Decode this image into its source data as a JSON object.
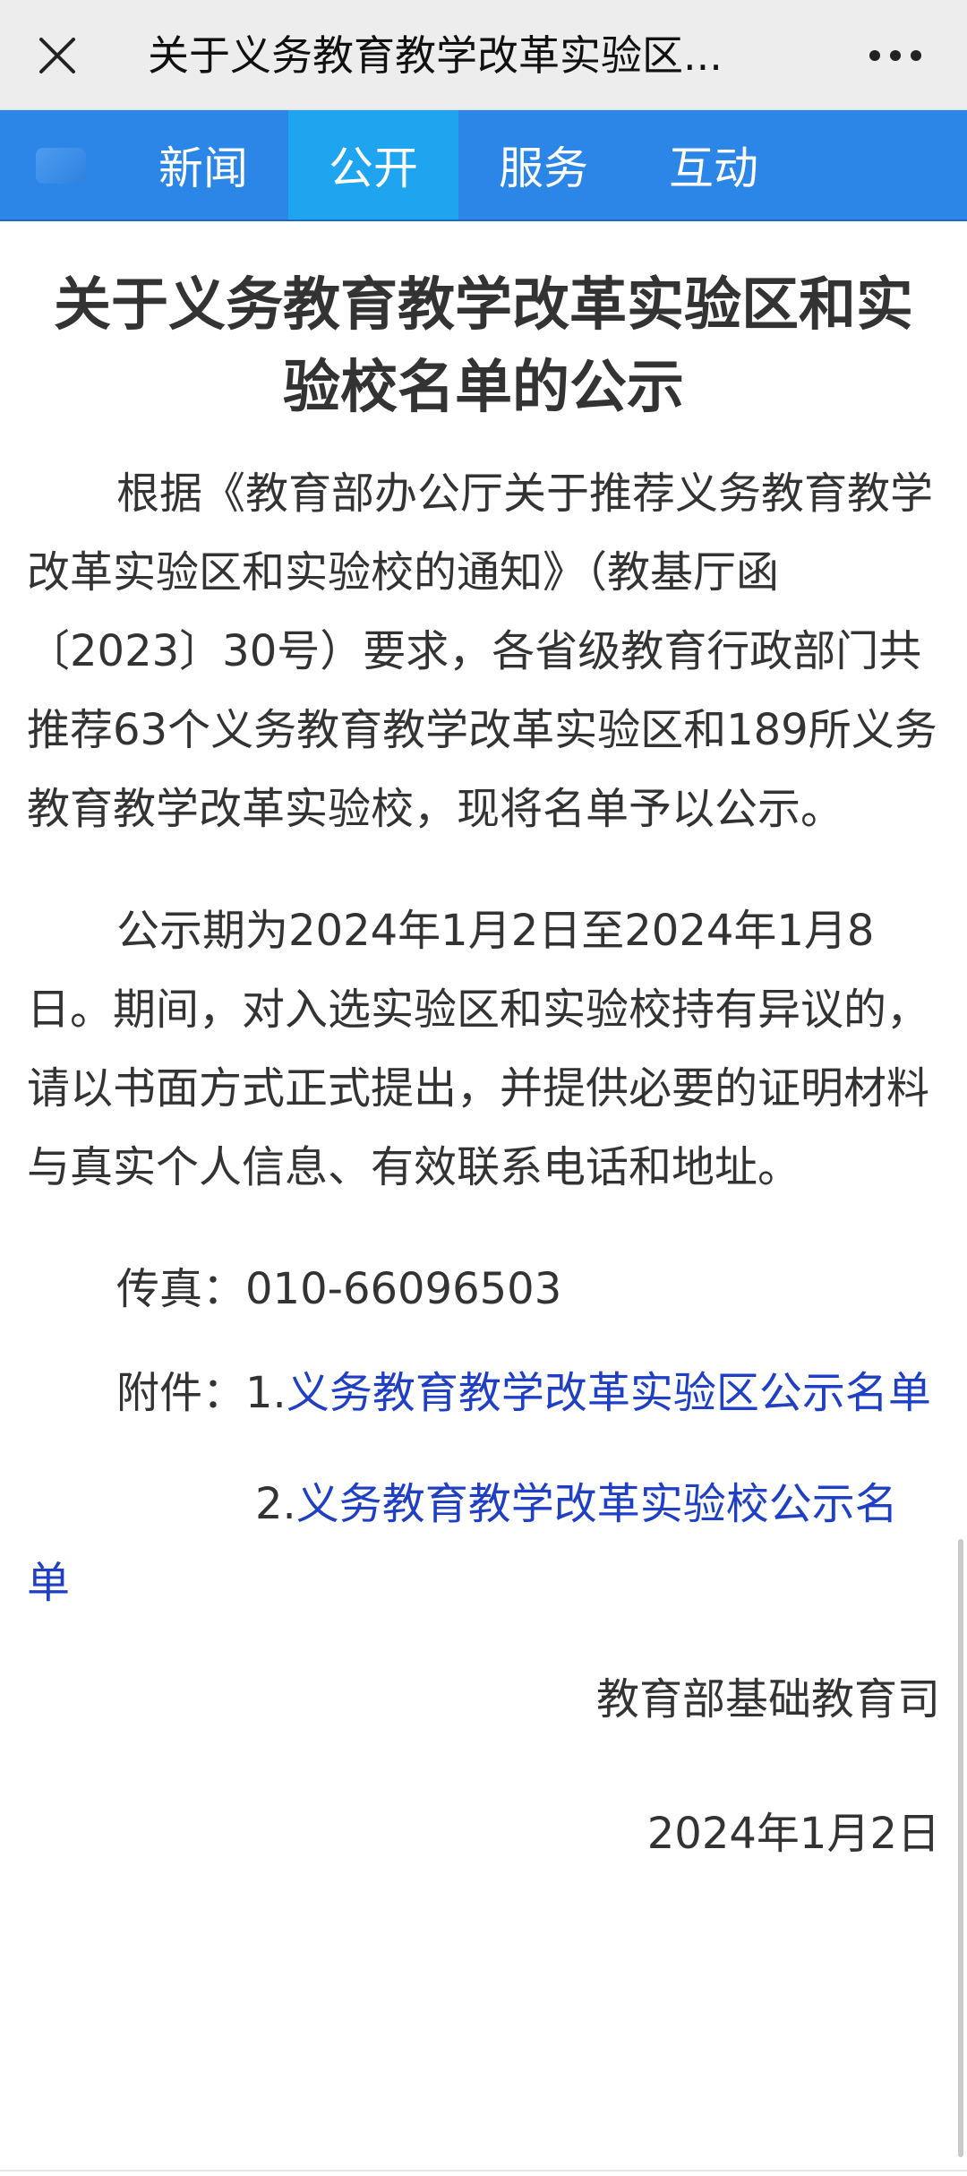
{
  "topbar": {
    "title": "关于义务教育教学改革实验区..."
  },
  "icons": {
    "close": "close-icon",
    "more": "more-dots-icon",
    "logo": "site-logo-icon"
  },
  "nav": {
    "tabs": [
      {
        "label": "新闻",
        "active": false
      },
      {
        "label": "公开",
        "active": true
      },
      {
        "label": "服务",
        "active": false
      },
      {
        "label": "互动",
        "active": false
      }
    ]
  },
  "article": {
    "title": "关于义务教育教学改革实验区和实验校名单的公示",
    "paragraph1": "根据《教育部办公厅关于推荐义务教育教学改革实验区和实验校的通知》（教基厅函〔2023〕30号）要求，各省级教育行政部门共推荐63个义务教育教学改革实验区和189所义务教育教学改革实验校，现将名单予以公示。",
    "paragraph2": "公示期为2024年1月2日至2024年1月8日。期间，对入选实验区和实验校持有异议的，请以书面方式正式提出，并提供必要的证明材料与真实个人信息、有效联系电话和地址。",
    "fax": "传真：010-66096503",
    "attachment_prefix": "附件：1.",
    "attachment1_link": "义务教育教学改革实验区公示名单",
    "attachment2_prefix": "2.",
    "attachment2_link": "义务教育教学改革实验校公示名单",
    "signature": "教育部基础教育司",
    "date": "2024年1月2日"
  },
  "colors": {
    "nav_bg": "#2c86e8",
    "nav_active": "#1fa5ef",
    "link": "#1f3fc4",
    "text": "#333333"
  }
}
